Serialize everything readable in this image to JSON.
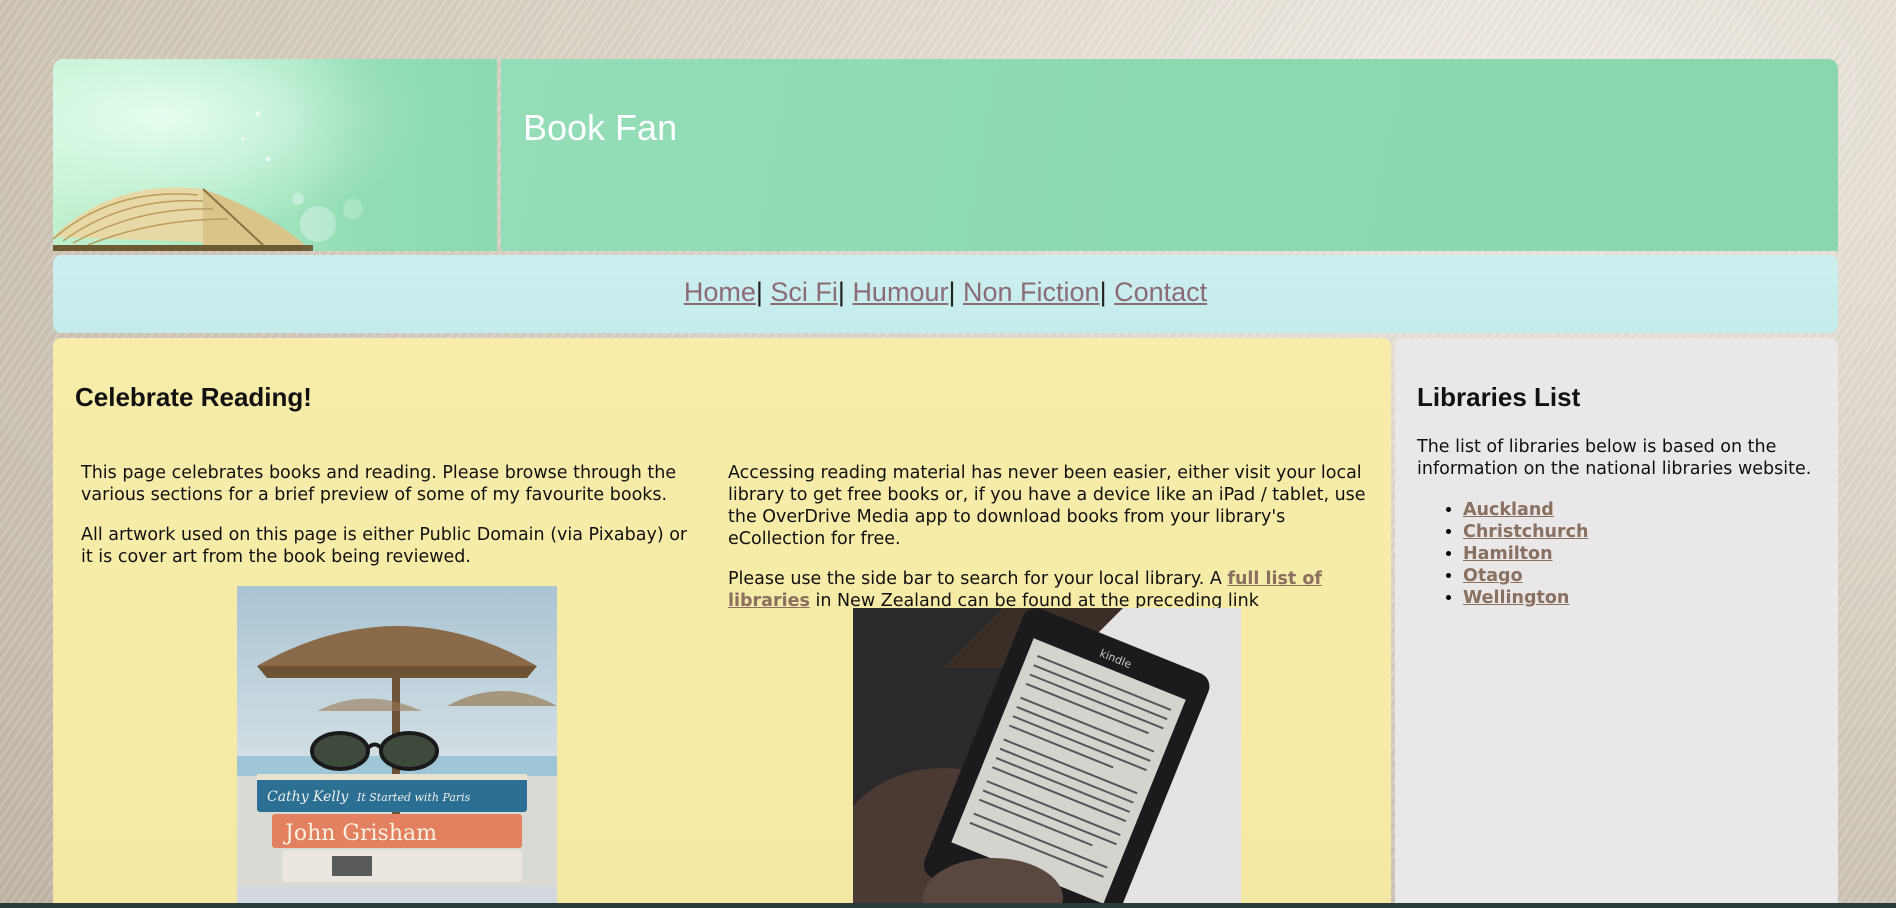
{
  "header": {
    "title": "Book Fan"
  },
  "nav": {
    "items": [
      {
        "label": "Home",
        "sep": "|"
      },
      {
        "label": "Sci Fi",
        "sep": "|"
      },
      {
        "label": "Humour",
        "sep": "|"
      },
      {
        "label": "Non Fiction",
        "sep": "|"
      },
      {
        "label": "Contact",
        "sep": ""
      }
    ]
  },
  "main": {
    "heading": "Celebrate Reading!",
    "left": {
      "p1": "This page celebrates books and reading. Please browse through the various sections for a brief preview of some of my favourite books.",
      "p2": "All artwork used on this page is either Public Domain (via Pixabay) or it is cover art from the book being reviewed."
    },
    "right": {
      "p1": "Accessing reading material has never been easier, either visit your local library to get free books or, if you have a device like an iPad / tablet, use the OverDrive Media app to download books from your library's eCollection for free.",
      "p2_before": "Please use the side bar to search for your local library. A ",
      "p2_link": "full list of libraries",
      "p2_after": " in New Zealand can be found at the preceding link"
    },
    "images": {
      "left_book_spines": [
        "Cathy Kelly",
        "It Started with Paris",
        "John Grisham"
      ],
      "right_device_brand": "kindle"
    }
  },
  "sidebar": {
    "heading": "Libraries List",
    "intro": "The list of libraries below is based on the information on the national libraries website.",
    "libraries": [
      "Auckland",
      "Christchurch",
      "Hamilton",
      "Otago",
      "Wellington"
    ]
  },
  "colors": {
    "banner": "#8cd8b1",
    "nav_bg": "#c6ecec",
    "link": "#8c6a78",
    "main_bg": "#f6eba7",
    "sidebar_bg": "#e9e7e7"
  }
}
